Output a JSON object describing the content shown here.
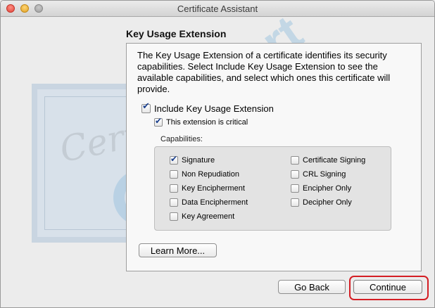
{
  "window": {
    "title": "Certificate Assistant"
  },
  "watermark": {
    "script": "Certificate",
    "brand": "digicert"
  },
  "section": {
    "heading": "Key Usage Extension"
  },
  "description": "The Key Usage Extension of a certificate identifies its security capabilities. Select Include Key Usage Extension to see the available capabilities, and select which ones this certificate will provide.",
  "include_extension": {
    "label": "Include Key Usage Extension",
    "checked": true
  },
  "critical": {
    "label": "This extension is critical",
    "checked": true
  },
  "capabilities": {
    "label": "Capabilities:",
    "left": [
      {
        "label": "Signature",
        "checked": true
      },
      {
        "label": "Non Repudiation",
        "checked": false
      },
      {
        "label": "Key Encipherment",
        "checked": false
      },
      {
        "label": "Data Encipherment",
        "checked": false
      },
      {
        "label": "Key Agreement",
        "checked": false
      }
    ],
    "right": [
      {
        "label": "Certificate Signing",
        "checked": false
      },
      {
        "label": "CRL Signing",
        "checked": false
      },
      {
        "label": "Encipher Only",
        "checked": false
      },
      {
        "label": "Decipher Only",
        "checked": false
      }
    ]
  },
  "buttons": {
    "learn_more": "Learn More...",
    "go_back": "Go Back",
    "continue": "Continue"
  },
  "colors": {
    "highlight": "#d41e24",
    "watermark": "#308ccd",
    "checkmark": "#1a3f8c"
  }
}
